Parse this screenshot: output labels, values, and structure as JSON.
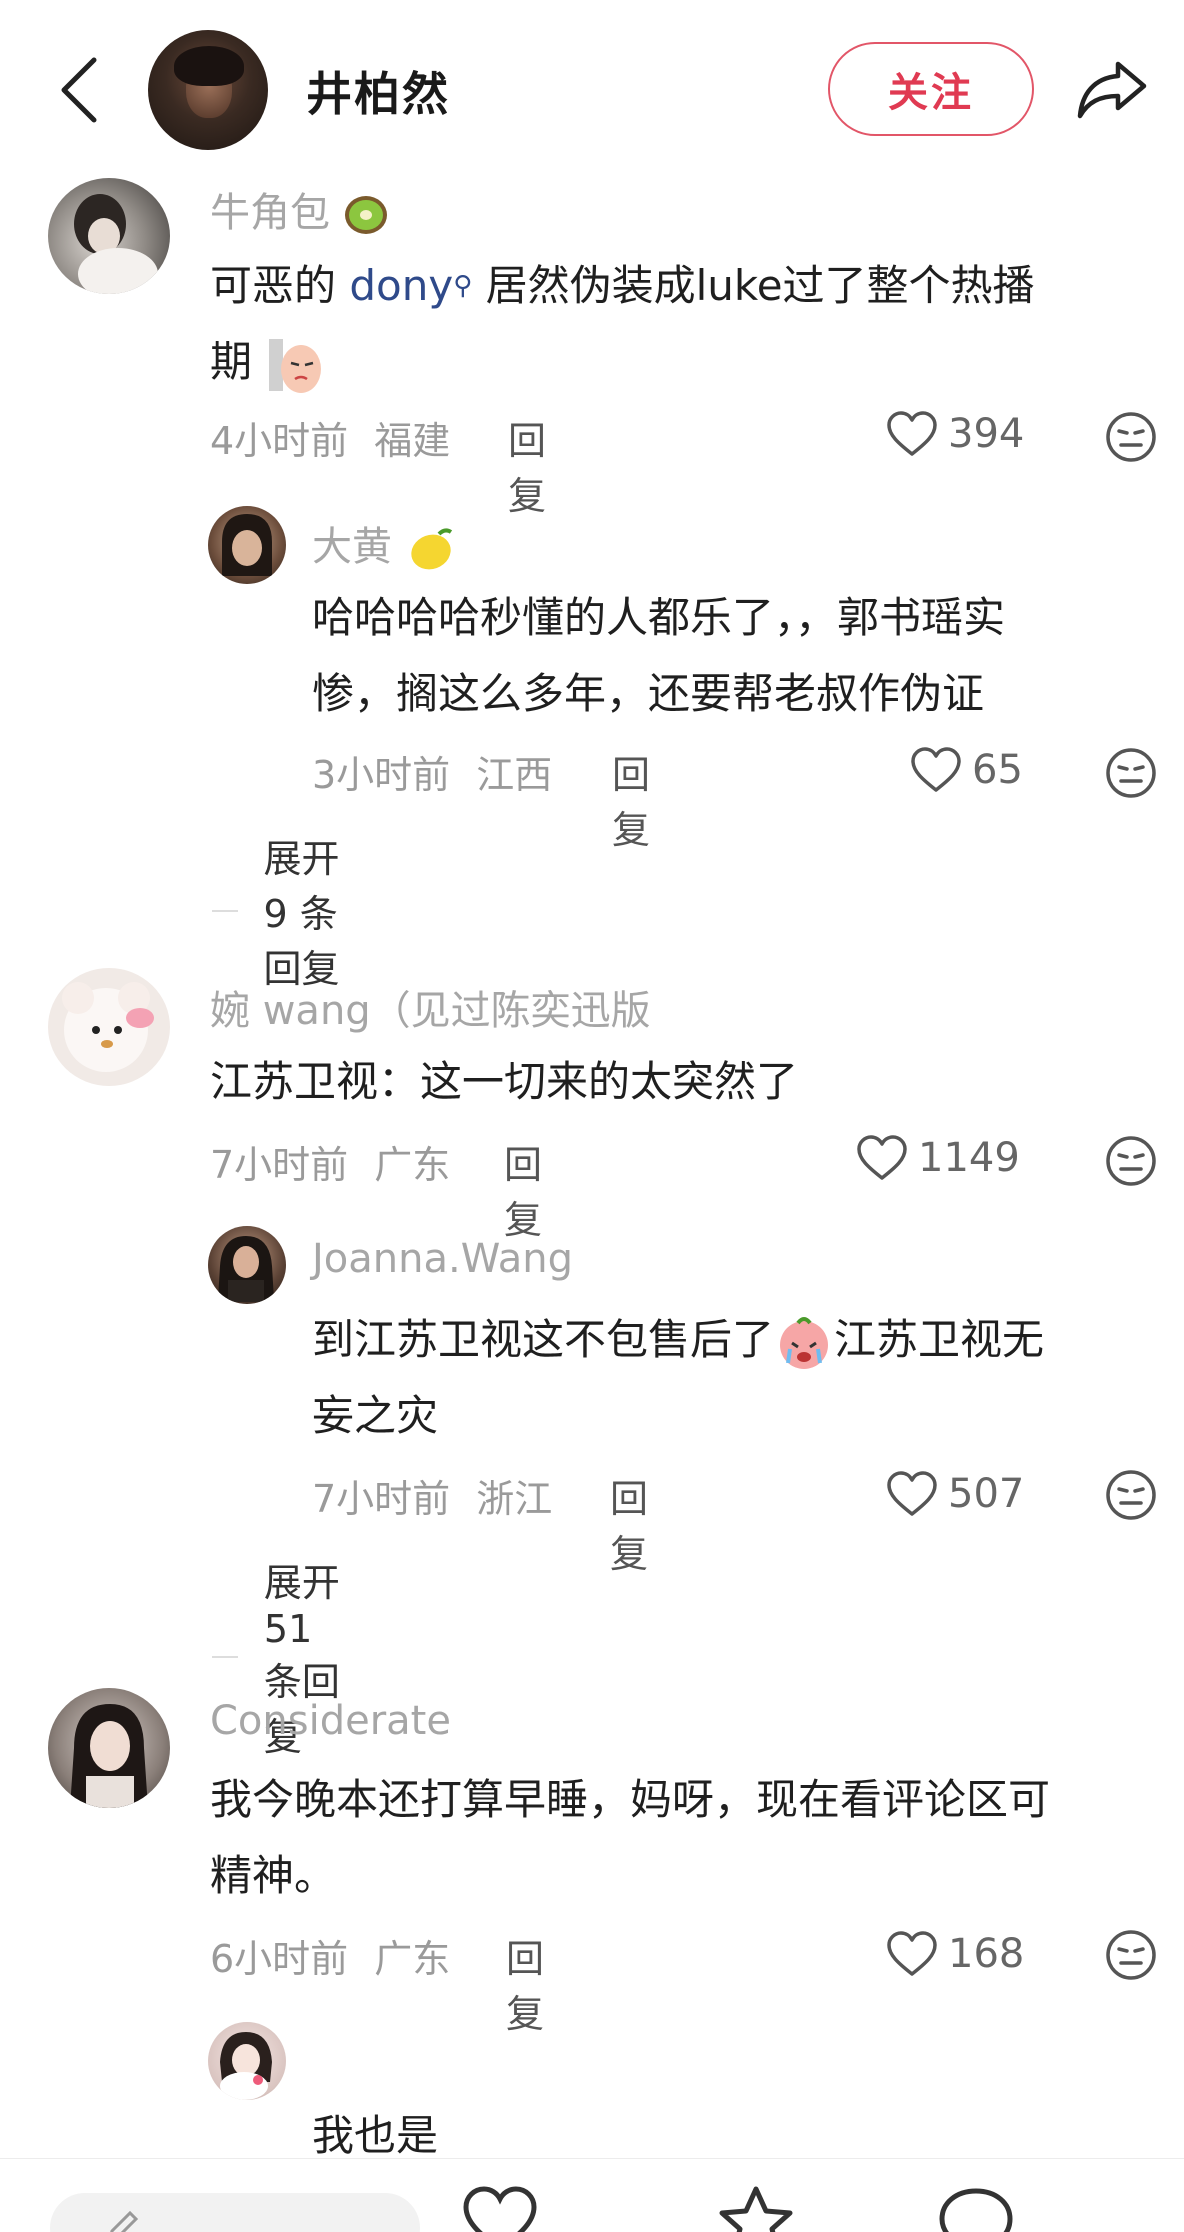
{
  "header": {
    "name": "井柏然",
    "follow_label": "关注"
  },
  "comments": [
    {
      "username": "牛角包",
      "text_before_mention": "可恶的 ",
      "mention": "dony",
      "text_after_mention": " 居然伪装成luke过了整个热播",
      "text_line2": "期",
      "time": "4小时前",
      "location": "福建",
      "reply_label": "回复",
      "likes": "394",
      "replies": [
        {
          "username": "大黄",
          "text_line1": "哈哈哈哈秒懂的人都乐了，，郭书瑶实",
          "text_line2": "惨，搁这么多年，还要帮老叔作伪证",
          "time": "3小时前",
          "location": "江西",
          "reply_label": "回复",
          "likes": "65"
        }
      ],
      "expand_label": "展开 9 条回复"
    },
    {
      "username": "婉 wang（见过陈奕迅版",
      "text_line1": "江苏卫视：这一切来的太突然了",
      "time": "7小时前",
      "location": "广东",
      "reply_label": "回复",
      "likes": "1149",
      "replies": [
        {
          "username": "Joanna.Wang",
          "text_line1": "到江苏卫视这不包售后了",
          "text_line1b": "江苏卫视无",
          "text_line2": "妄之灾",
          "time": "7小时前",
          "location": "浙江",
          "reply_label": "回复",
          "likes": "507"
        }
      ],
      "expand_label": "展开 51 条回复"
    },
    {
      "username": "Considerate",
      "text_line1": "我今晚本还打算早睡，妈呀，现在看评论区可",
      "text_line2": "精神。",
      "time": "6小时前",
      "location": "广东",
      "reply_label": "回复",
      "likes": "168",
      "replies": [
        {
          "text_line1": "我也是"
        }
      ]
    }
  ],
  "colors": {
    "follow_border": "#e25668",
    "follow_text": "#e03a52",
    "username": "#a6a6a6",
    "meta": "#9a9a9a",
    "mention": "#2f4a8a"
  },
  "icons": [
    "back-arrow-icon",
    "share-icon",
    "heart-icon",
    "dislike-face-icon",
    "kiwi-emoji",
    "lemon-emoji",
    "crying-emoji",
    "smug-emoji",
    "search-mention-icon"
  ]
}
